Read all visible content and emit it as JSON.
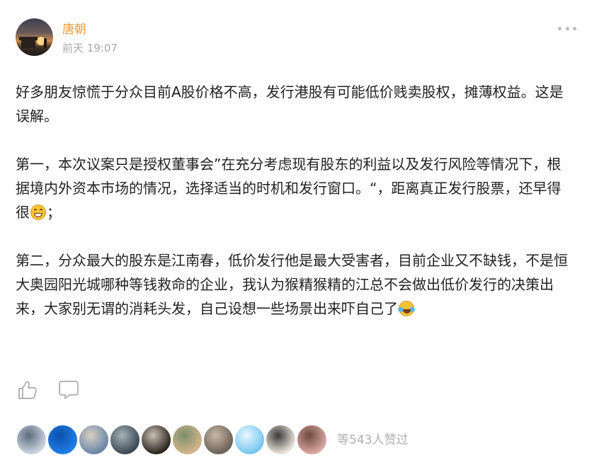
{
  "author": {
    "name": "唐朝",
    "time": "前天 19:07"
  },
  "post": {
    "paragraphs": [
      {
        "text": "好多朋友惊慌于分众目前A股价格不高，发行港股有可能低价贱卖股权，摊薄权益。这是误解。"
      },
      {
        "text": "第一，本次议案只是授权董事会”在充分考虑现有股东的利益以及发行风险等情况下，根据境内外资本市场的情况，选择适当的时机和发行窗口。“，距离真正发行股票，还早得很",
        "emoji": "grin",
        "after": "；"
      },
      {
        "text": "第二，分众最大的股东是江南春，低价发行他是最大受害者，目前企业又不缺钱，不是恒大奥园阳光城哪种等钱救命的企业，我认为猴精猴精的江总不会做出低价发行的决策出来，大家别无谓的消耗头发，自己设想一些场景出来吓自己了",
        "emoji": "cry"
      }
    ]
  },
  "actions": {
    "like_icon": "thumbs-up-icon",
    "comment_icon": "comment-bubble-icon"
  },
  "likes": {
    "count_text": "等543人赞过",
    "avatars": [
      {
        "colors": [
          "#c9d3df",
          "#5c6b7e"
        ]
      },
      {
        "colors": [
          "#1f7ee6",
          "#0b4ea8"
        ]
      },
      {
        "colors": [
          "#6c86a8",
          "#d8d0c4"
        ]
      },
      {
        "colors": [
          "#3d4a55",
          "#a7b3b8"
        ]
      },
      {
        "colors": [
          "#2c2622",
          "#cbbfb1"
        ]
      },
      {
        "colors": [
          "#d2b48c",
          "#7a8f6a"
        ]
      },
      {
        "colors": [
          "#6e6257",
          "#c7b9a8"
        ]
      },
      {
        "colors": [
          "#78c7f0",
          "#e9f6ff"
        ]
      },
      {
        "colors": [
          "#e9e2d9",
          "#3b3b3b"
        ]
      },
      {
        "colors": [
          "#d9a6a0",
          "#6c4b3f"
        ]
      }
    ]
  },
  "colors": {
    "author": "#ef9b3b",
    "meta": "#a8a8a8",
    "body": "#222222",
    "icon": "#b5b5b5"
  }
}
